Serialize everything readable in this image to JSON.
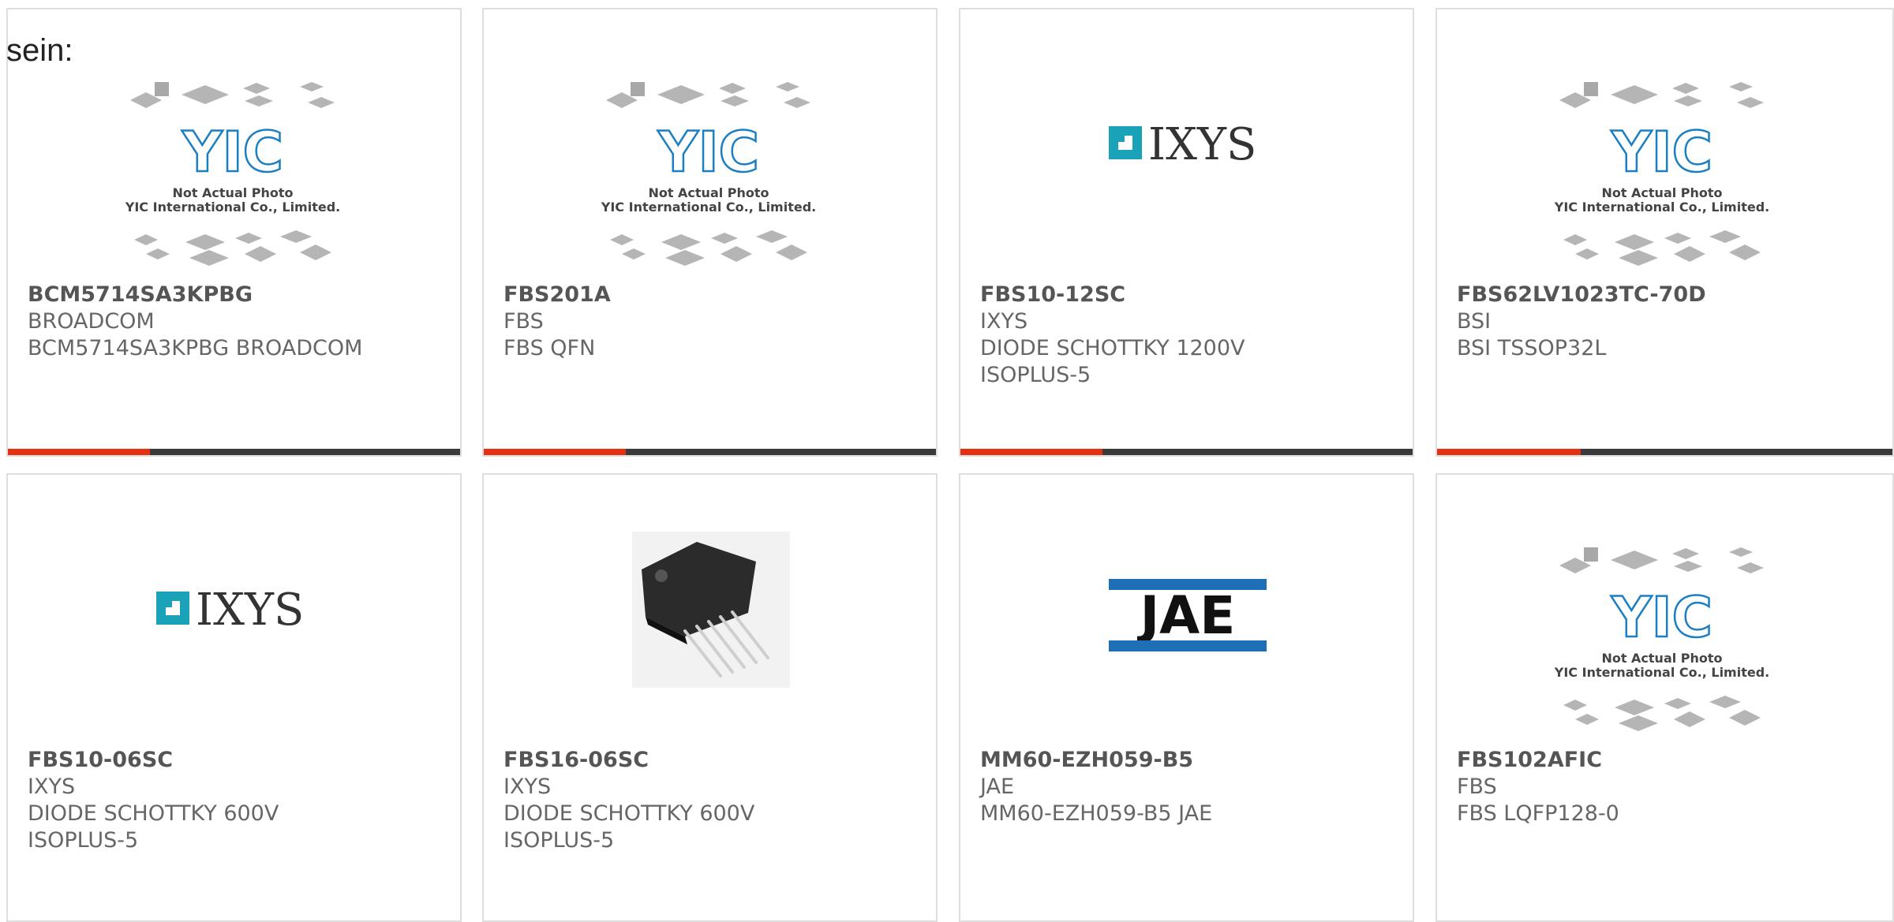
{
  "lead_text": "sein:",
  "colors": {
    "accent": "#e63012",
    "bar": "#3a3a3a",
    "border": "#dedede",
    "text": "#666666",
    "ixys_teal": "#1aa3b8",
    "jae_blue": "#1f6fb6"
  },
  "placeholder": {
    "brand": "YIC",
    "line1": "Not Actual Photo",
    "line2": "YIC International Co., Limited."
  },
  "logos": {
    "ixys": "IXYS",
    "jae": "JAE"
  },
  "products": [
    {
      "part": "BCM5714SA3KPBG",
      "maker": "BROADCOM",
      "desc": [
        "BCM5714SA3KPBG BROADCOM"
      ],
      "image": "yic-placeholder"
    },
    {
      "part": "FBS201A",
      "maker": "FBS",
      "desc": [
        "FBS QFN"
      ],
      "image": "yic-placeholder"
    },
    {
      "part": "FBS10-12SC",
      "maker": "IXYS",
      "desc": [
        "DIODE SCHOTTKY 1200V",
        "ISOPLUS-5"
      ],
      "image": "ixys-logo"
    },
    {
      "part": "FBS62LV1023TC-70D",
      "maker": "BSI",
      "desc": [
        "BSI TSSOP32L"
      ],
      "image": "yic-placeholder"
    },
    {
      "part": "FBS10-06SC",
      "maker": "IXYS",
      "desc": [
        "DIODE SCHOTTKY 600V",
        "ISOPLUS-5"
      ],
      "image": "ixys-logo"
    },
    {
      "part": "FBS16-06SC",
      "maker": "IXYS",
      "desc": [
        "DIODE SCHOTTKY 600V",
        "ISOPLUS-5"
      ],
      "image": "component-photo"
    },
    {
      "part": "MM60-EZH059-B5",
      "maker": "JAE",
      "desc": [
        "MM60-EZH059-B5 JAE"
      ],
      "image": "jae-logo"
    },
    {
      "part": "FBS102AFIC",
      "maker": "FBS",
      "desc": [
        "FBS LQFP128-0"
      ],
      "image": "yic-placeholder"
    }
  ]
}
